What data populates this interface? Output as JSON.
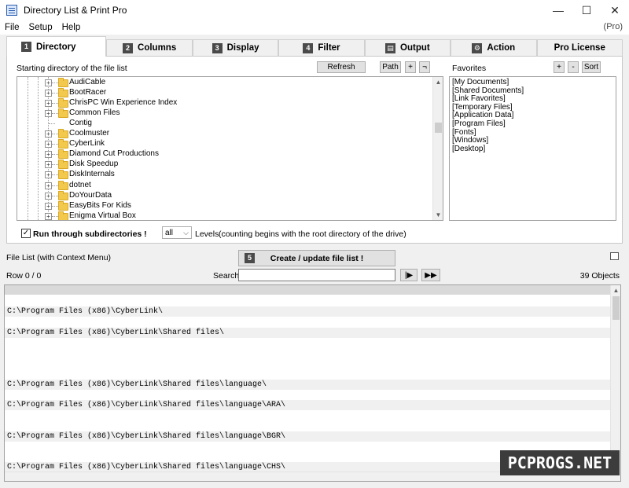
{
  "window": {
    "title": "Directory List & Print Pro",
    "minimize": "—",
    "maximize": "☐",
    "close": "✕"
  },
  "menu": {
    "items": [
      "File",
      "Setup",
      "Help"
    ],
    "pro_tag": "(Pro)"
  },
  "tabs": [
    {
      "num": "1",
      "label": "Directory"
    },
    {
      "num": "2",
      "label": "Columns"
    },
    {
      "num": "3",
      "label": "Display"
    },
    {
      "num": "4",
      "label": "Filter"
    },
    {
      "num": "▤",
      "label": "Output"
    },
    {
      "num": "⚙",
      "label": "Action"
    },
    {
      "num": "",
      "label": "Pro License"
    }
  ],
  "directory": {
    "start_label": "Starting directory of the file list",
    "refresh": "Refresh",
    "path": "Path",
    "plus": "+",
    "minus": "¬",
    "tree": [
      {
        "label": "AudiCable",
        "expandable": true
      },
      {
        "label": "BootRacer",
        "expandable": true
      },
      {
        "label": "ChrisPC Win Experience Index",
        "expandable": true
      },
      {
        "label": "Common Files",
        "expandable": true
      },
      {
        "label": "Contig",
        "expandable": false
      },
      {
        "label": "Coolmuster",
        "expandable": true
      },
      {
        "label": "CyberLink",
        "expandable": true
      },
      {
        "label": "Diamond Cut Productions",
        "expandable": true
      },
      {
        "label": "Disk Speedup",
        "expandable": true
      },
      {
        "label": "DiskInternals",
        "expandable": true
      },
      {
        "label": "dotnet",
        "expandable": true
      },
      {
        "label": "DoYourData",
        "expandable": true
      },
      {
        "label": "EasyBits For Kids",
        "expandable": true
      },
      {
        "label": "Enigma Virtual Box",
        "expandable": true
      }
    ],
    "favorites": {
      "label": "Favorites",
      "plus": "+",
      "minus": "-",
      "sort": "Sort",
      "items": [
        "[My Documents]",
        "[Shared Documents]",
        "[Link Favorites]",
        "[Temporary Files]",
        "[Application Data]",
        "[Program Files]",
        "[Fonts]",
        "[Windows]",
        "[Desktop]"
      ]
    },
    "subdirs_label": "Run through subdirectories !",
    "subdirs_checked": "✓",
    "levels_value": "all",
    "levels_caret": "⌵",
    "levels_label": "Levels",
    "levels_note": "(counting begins with the root directory of the drive)"
  },
  "filelist": {
    "label": "File List (with Context Menu)",
    "create_num": "5",
    "create_btn": "Create / update file list !",
    "row": "Row 0 / 0",
    "search_label": "Search",
    "search_value": "",
    "next": "|▶",
    "next_all": "▶▶",
    "objects": "39 Objects",
    "rows": [
      {
        "text": "",
        "shade": false
      },
      {
        "text": "C:\\Program Files (x86)\\CyberLink\\",
        "shade": true
      },
      {
        "text": "",
        "shade": false
      },
      {
        "text": "C:\\Program Files (x86)\\CyberLink\\Shared files\\",
        "shade": true
      },
      {
        "text": "",
        "shade": false
      },
      {
        "text": "",
        "shade": false
      },
      {
        "text": "",
        "shade": false
      },
      {
        "text": "",
        "shade": false
      },
      {
        "text": "C:\\Program Files (x86)\\CyberLink\\Shared files\\language\\",
        "shade": true
      },
      {
        "text": "",
        "shade": false
      },
      {
        "text": "C:\\Program Files (x86)\\CyberLink\\Shared files\\language\\ARA\\",
        "shade": true
      },
      {
        "text": "",
        "shade": false
      },
      {
        "text": "",
        "shade": false
      },
      {
        "text": "C:\\Program Files (x86)\\CyberLink\\Shared files\\language\\BGR\\",
        "shade": true
      },
      {
        "text": "",
        "shade": false
      },
      {
        "text": "",
        "shade": false
      },
      {
        "text": "C:\\Program Files (x86)\\CyberLink\\Shared files\\language\\CHS\\",
        "shade": true
      }
    ]
  },
  "watermark": "PCPROGS.NET"
}
